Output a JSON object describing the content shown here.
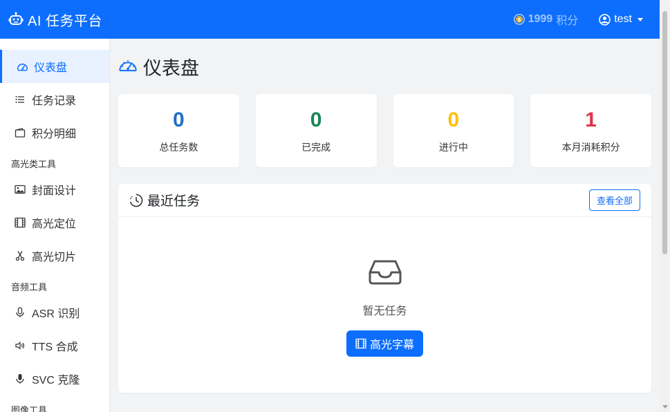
{
  "navbar": {
    "brand": "AI 任务平台",
    "points_value": "1999",
    "points_unit": "积分",
    "user": "test"
  },
  "sidebar": {
    "items": [
      {
        "label": "仪表盘",
        "icon": "speedometer-icon",
        "active": true
      },
      {
        "label": "任务记录",
        "icon": "list-icon"
      },
      {
        "label": "积分明细",
        "icon": "wallet-icon"
      }
    ],
    "section_highlight": "高光类工具",
    "highlight_items": [
      {
        "label": "封面设计",
        "icon": "image-icon"
      },
      {
        "label": "高光定位",
        "icon": "film-icon"
      },
      {
        "label": "高光切片",
        "icon": "scissors-icon"
      }
    ],
    "section_audio": "音频工具",
    "audio_items": [
      {
        "label": "ASR 识别",
        "icon": "mic-icon"
      },
      {
        "label": "TTS 合成",
        "icon": "volume-icon"
      },
      {
        "label": "SVC 克隆",
        "icon": "mic-fill-icon"
      }
    ],
    "section_image": "图像工具"
  },
  "main": {
    "title": "仪表盘",
    "stats": [
      {
        "value": "0",
        "label": "总任务数",
        "color": "#1f6fc5"
      },
      {
        "value": "0",
        "label": "已完成",
        "color": "#198754"
      },
      {
        "value": "0",
        "label": "进行中",
        "color": "#ffc107"
      },
      {
        "value": "1",
        "label": "本月消耗积分",
        "color": "#dc3545"
      }
    ],
    "recent": {
      "title": "最近任务",
      "view_all": "查看全部",
      "empty_text": "暂无任务",
      "cta": "高光字幕"
    }
  },
  "colors": {
    "primary": "#0d6efd",
    "success": "#198754",
    "warning": "#ffc107",
    "danger": "#dc3545"
  }
}
